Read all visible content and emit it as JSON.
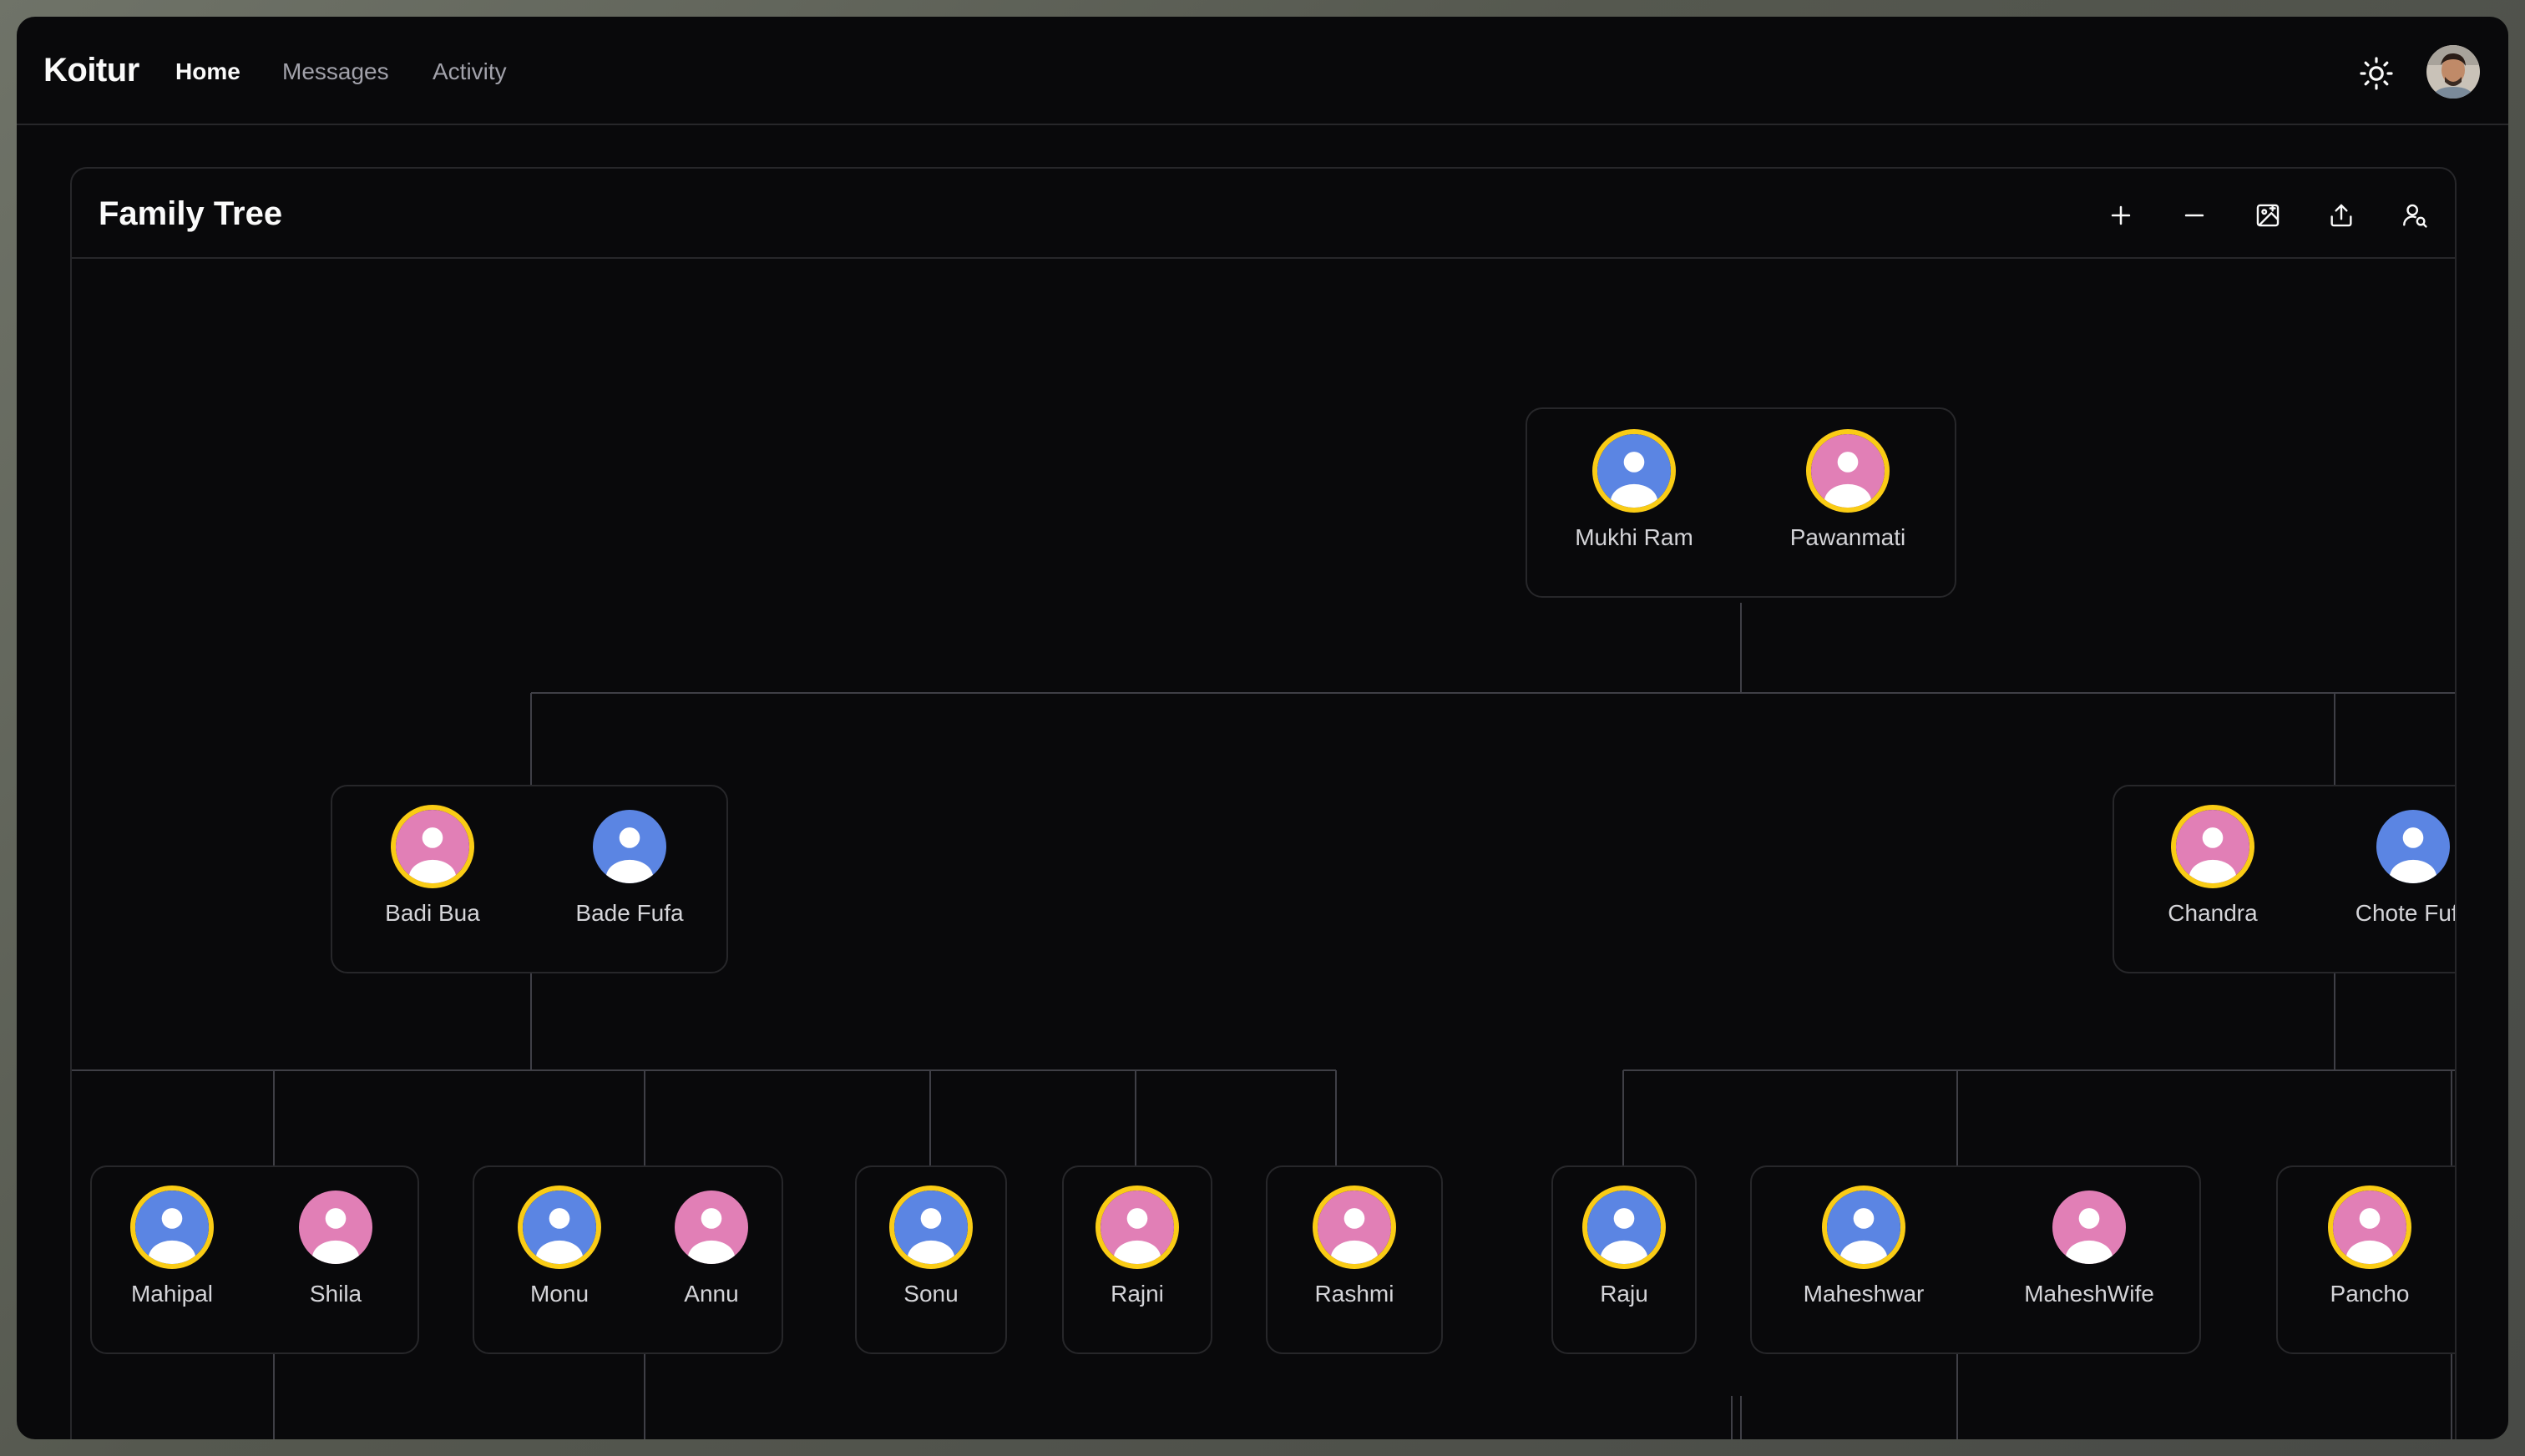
{
  "app": {
    "brand": "Koitur",
    "nav": [
      {
        "label": "Home",
        "active": true
      },
      {
        "label": "Messages",
        "active": false
      },
      {
        "label": "Activity",
        "active": false
      }
    ]
  },
  "panel": {
    "title": "Family Tree",
    "tools": [
      "plus-icon",
      "minus-icon",
      "image-export-icon",
      "share-icon",
      "user-search-icon"
    ]
  },
  "colors": {
    "male": "#5b85e3",
    "female": "#e17fb6",
    "highlight": "#facc15",
    "line": "#3f3f46"
  },
  "people": {
    "mukhi_ram": {
      "name": "Mukhi Ram",
      "gender": "male",
      "highlighted": true
    },
    "pawanmati": {
      "name": "Pawanmati",
      "gender": "female",
      "highlighted": true
    },
    "badi_bua": {
      "name": "Badi Bua",
      "gender": "female",
      "highlighted": true
    },
    "bade_fufa": {
      "name": "Bade Fufa",
      "gender": "male",
      "highlighted": false
    },
    "chandra": {
      "name": "Chandra",
      "gender": "female",
      "highlighted": true
    },
    "chote_fufa": {
      "name": "Chote Fufa",
      "gender": "male",
      "highlighted": false
    },
    "mahipal": {
      "name": "Mahipal",
      "gender": "male",
      "highlighted": true
    },
    "shila": {
      "name": "Shila",
      "gender": "female",
      "highlighted": false
    },
    "monu": {
      "name": "Monu",
      "gender": "male",
      "highlighted": true
    },
    "annu": {
      "name": "Annu",
      "gender": "female",
      "highlighted": false
    },
    "sonu": {
      "name": "Sonu",
      "gender": "male",
      "highlighted": true
    },
    "rajni": {
      "name": "Rajni",
      "gender": "female",
      "highlighted": true
    },
    "rashmi": {
      "name": "Rashmi",
      "gender": "female",
      "highlighted": true
    },
    "raju": {
      "name": "Raju",
      "gender": "male",
      "highlighted": true
    },
    "maheshwar": {
      "name": "Maheshwar",
      "gender": "male",
      "highlighted": true
    },
    "maheshwife": {
      "name": "MaheshWife",
      "gender": "female",
      "highlighted": false
    },
    "pancho": {
      "name": "Pancho",
      "gender": "female",
      "highlighted": true
    }
  }
}
